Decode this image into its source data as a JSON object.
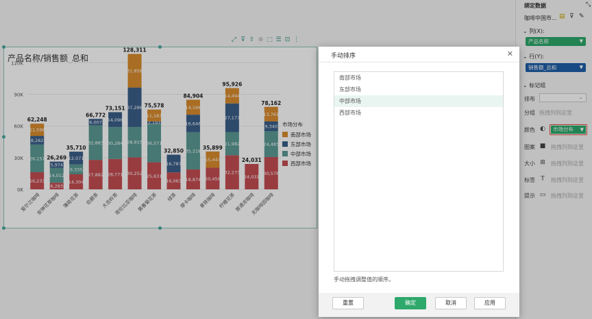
{
  "chart": {
    "title": "产品名称/销售额_总和",
    "toolbar_icons": [
      "expand-icon",
      "filter-icon",
      "export-icon",
      "zoom-icon",
      "select-icon",
      "list-icon",
      "layout-icon",
      "more-icon"
    ]
  },
  "chart_data": {
    "type": "bar",
    "stacked": true,
    "title": "产品名称/销售额_总和",
    "categories": [
      "爱尔兰咖啡",
      "安神花草咖啡",
      "薄荷花茶",
      "伯爵茶",
      "大吉岭茶",
      "哥伦比亚咖啡",
      "黄春菊花茶",
      "绿茶",
      "摩卡咖啡",
      "拿铁咖啡",
      "柠檬花茶",
      "普通浓咖啡",
      "无咖啡因咖啡"
    ],
    "y_ticks": [
      "0K",
      "30K",
      "60K",
      "90K",
      "120K"
    ],
    "ylim": [
      0,
      130000
    ],
    "legend_title": "市场分布",
    "legend_position": "right",
    "series": [
      {
        "name": "西部市场",
        "color": "#c44e52",
        "values": [
          16233,
          6283,
          14304,
          27882,
          28771,
          30252,
          25631,
          16063,
          18874,
          20456,
          32273,
          24031,
          30578
        ]
      },
      {
        "name": "中部市场",
        "color": "#5b9a94",
        "values": [
          26157,
          14012,
          9335,
          32883,
          30284,
          28915,
          36571,
          0,
          35218,
          0,
          21982,
          0,
          24483
        ]
      },
      {
        "name": "东部市场",
        "color": "#3b5f8a",
        "values": [
          8262,
          5974,
          12071,
          6007,
          14096,
          37286,
          2193,
          16787,
          16646,
          0,
          27177,
          0,
          9340
        ]
      },
      {
        "name": "南部市场",
        "color": "#d98c2e",
        "values": [
          11596,
          0,
          0,
          0,
          0,
          31858,
          11183,
          0,
          14166,
          15443,
          14494,
          0,
          13761
        ]
      }
    ],
    "totals": [
      "62,248",
      "26,269",
      "35,710",
      "66,772",
      "73,151",
      "128,311",
      "75,578",
      "32,850",
      "84,904",
      "35,899",
      "95,926",
      "24,031",
      "78,162"
    ],
    "segment_labels": [
      [
        "16,233",
        "26,157",
        "8,262",
        "11,596"
      ],
      [
        "6,283",
        "14,012",
        "5,974",
        ""
      ],
      [
        "14,304",
        "9,335",
        "12,071",
        ""
      ],
      [
        "27,882",
        "32,883",
        "6,007",
        ""
      ],
      [
        "28,771",
        "30,284",
        "14,096",
        ""
      ],
      [
        "30,252",
        "28,915",
        "37,286",
        "31,858"
      ],
      [
        "25,631",
        "36,571",
        "2,193",
        "11,183"
      ],
      [
        "16,063",
        "",
        "16,787",
        ""
      ],
      [
        "18,874",
        "35,218",
        "16,646",
        "14,166"
      ],
      [
        "20,456",
        "",
        "",
        "15,443"
      ],
      [
        "32,273",
        "21,982",
        "27,177",
        "14,494"
      ],
      [
        "24,031",
        "",
        "",
        ""
      ],
      [
        "30,578",
        "24,483",
        "9,340",
        "13,761"
      ]
    ]
  },
  "dialog": {
    "title": "手动排序",
    "items": [
      "南部市场",
      "东部市场",
      "中部市场",
      "西部市场"
    ],
    "selected_index": 2,
    "hint": "手动拖拽调整值的顺序。",
    "buttons": {
      "reset": "重置",
      "ok": "确定",
      "cancel": "取消",
      "apply": "应用"
    }
  },
  "panel": {
    "title": "绑定数据",
    "source": "咖啡中国市...",
    "columns_label": "列(X):",
    "columns_field": "产品名称",
    "rows_label": "行(Y):",
    "rows_field": "销售额_总和",
    "marks_label": "标记组",
    "layout_label": "排布",
    "group_label": "分组",
    "group_drop": "拖拽列到这里",
    "color_label": "颜色",
    "color_field": "市场分布",
    "pattern_label": "图案",
    "pattern_drop": "拖拽列到这里",
    "size_label": "大小",
    "size_drop": "拖拽列到这里",
    "tag_label": "标签",
    "tag_drop": "拖拽列到这里",
    "tip_label": "提示",
    "tip_drop": "拖拽列到这里",
    "accent_green": "#2ea86b",
    "accent_blue": "#1f5fa8"
  }
}
